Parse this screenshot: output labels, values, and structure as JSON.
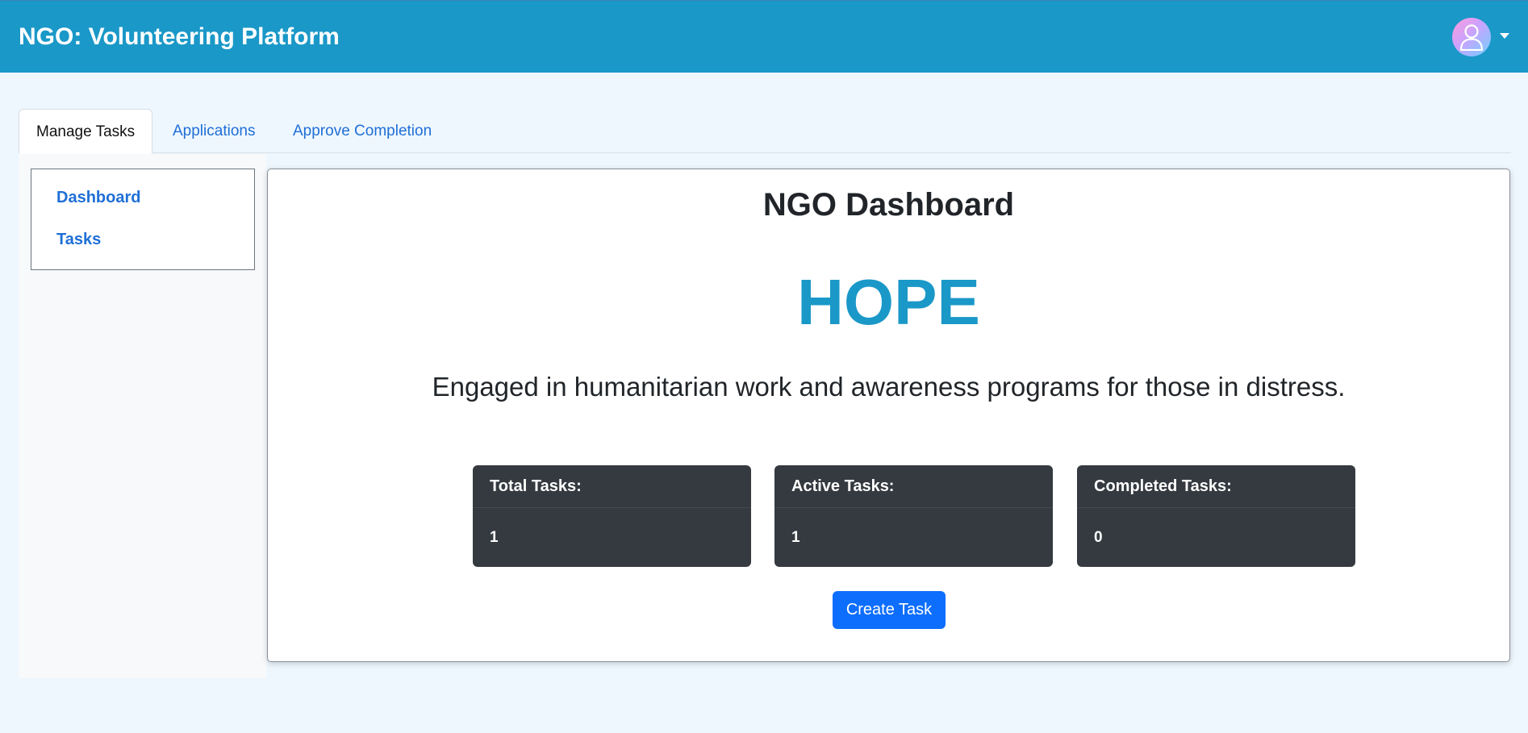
{
  "header": {
    "title": "NGO: Volunteering Platform",
    "avatar_icon": "user-avatar-icon",
    "menu_icon": "caret-down-icon"
  },
  "tabs": [
    {
      "label": "Manage Tasks",
      "active": true
    },
    {
      "label": "Applications",
      "active": false
    },
    {
      "label": "Approve Completion",
      "active": false
    }
  ],
  "sidebar": {
    "items": [
      {
        "label": "Dashboard"
      },
      {
        "label": "Tasks"
      }
    ]
  },
  "dashboard": {
    "title": "NGO Dashboard",
    "org_name": "HOPE",
    "description": "Engaged in humanitarian work and awareness programs for those in distress.",
    "stats": [
      {
        "label": "Total Tasks:",
        "value": "1"
      },
      {
        "label": "Active Tasks:",
        "value": "1"
      },
      {
        "label": "Completed Tasks:",
        "value": "0"
      }
    ],
    "create_button": "Create Task"
  },
  "colors": {
    "header_bg": "#1a98c8",
    "page_bg": "#eef6fe",
    "link": "#1f6fd6",
    "stat_card_bg": "#343a40",
    "primary_button": "#0d6efd"
  }
}
